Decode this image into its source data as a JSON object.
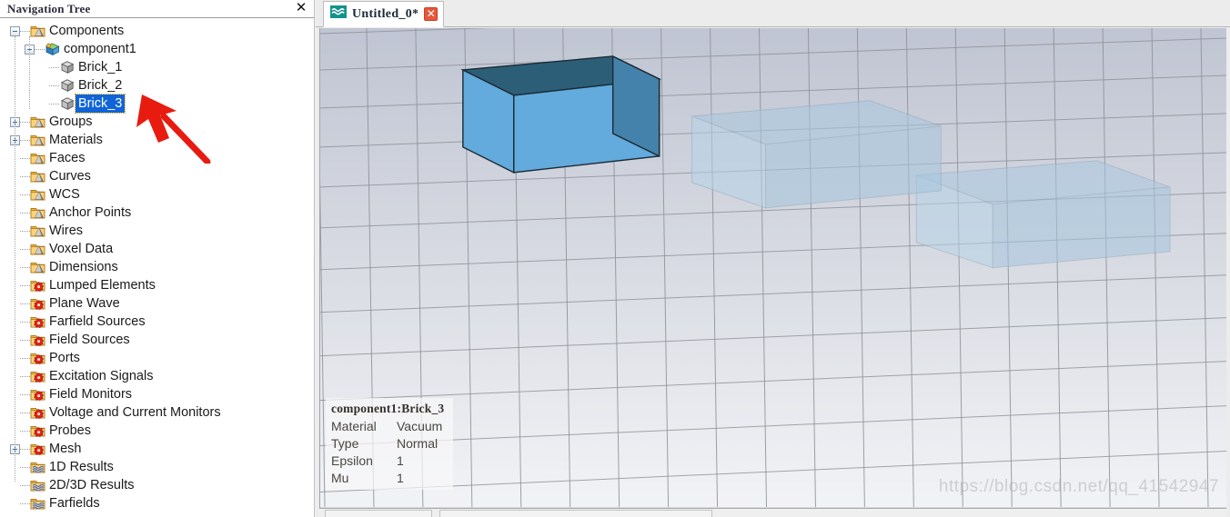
{
  "panel": {
    "title": "Navigation Tree",
    "close_icon": "close-icon",
    "close_label": "✕"
  },
  "tree": {
    "items": [
      {
        "label": "Components",
        "depth": 0,
        "expander": "minus",
        "icon": "folder-cone-icon",
        "selected": false
      },
      {
        "label": "component1",
        "depth": 1,
        "expander": "minus",
        "icon": "component-cube-icon",
        "selected": false
      },
      {
        "label": "Brick_1",
        "depth": 2,
        "expander": "none",
        "icon": "brick-icon",
        "selected": false
      },
      {
        "label": "Brick_2",
        "depth": 2,
        "expander": "none",
        "icon": "brick-icon",
        "selected": false
      },
      {
        "label": "Brick_3",
        "depth": 2,
        "expander": "none",
        "icon": "brick-icon",
        "selected": true
      },
      {
        "label": "Groups",
        "depth": 0,
        "expander": "plus",
        "icon": "folder-cone-icon",
        "selected": false
      },
      {
        "label": "Materials",
        "depth": 0,
        "expander": "plus",
        "icon": "folder-cone-icon",
        "selected": false
      },
      {
        "label": "Faces",
        "depth": 0,
        "expander": "none",
        "icon": "folder-cone-icon",
        "selected": false
      },
      {
        "label": "Curves",
        "depth": 0,
        "expander": "none",
        "icon": "folder-cone-icon",
        "selected": false
      },
      {
        "label": "WCS",
        "depth": 0,
        "expander": "none",
        "icon": "folder-cone-icon",
        "selected": false
      },
      {
        "label": "Anchor Points",
        "depth": 0,
        "expander": "none",
        "icon": "folder-cone-icon",
        "selected": false
      },
      {
        "label": "Wires",
        "depth": 0,
        "expander": "none",
        "icon": "folder-cone-icon",
        "selected": false
      },
      {
        "label": "Voxel Data",
        "depth": 0,
        "expander": "none",
        "icon": "folder-cone-icon",
        "selected": false
      },
      {
        "label": "Dimensions",
        "depth": 0,
        "expander": "none",
        "icon": "folder-cone-icon",
        "selected": false
      },
      {
        "label": "Lumped Elements",
        "depth": 0,
        "expander": "none",
        "icon": "folder-gear-icon",
        "selected": false
      },
      {
        "label": "Plane Wave",
        "depth": 0,
        "expander": "none",
        "icon": "folder-gear-icon",
        "selected": false
      },
      {
        "label": "Farfield Sources",
        "depth": 0,
        "expander": "none",
        "icon": "folder-gear-icon",
        "selected": false
      },
      {
        "label": "Field Sources",
        "depth": 0,
        "expander": "none",
        "icon": "folder-gear-icon",
        "selected": false
      },
      {
        "label": "Ports",
        "depth": 0,
        "expander": "none",
        "icon": "folder-gear-icon",
        "selected": false
      },
      {
        "label": "Excitation Signals",
        "depth": 0,
        "expander": "none",
        "icon": "folder-gear-icon",
        "selected": false
      },
      {
        "label": "Field Monitors",
        "depth": 0,
        "expander": "none",
        "icon": "folder-gear-icon",
        "selected": false
      },
      {
        "label": "Voltage and Current Monitors",
        "depth": 0,
        "expander": "none",
        "icon": "folder-gear-icon",
        "selected": false
      },
      {
        "label": "Probes",
        "depth": 0,
        "expander": "none",
        "icon": "folder-gear-icon",
        "selected": false
      },
      {
        "label": "Mesh",
        "depth": 0,
        "expander": "plus",
        "icon": "folder-gear-icon",
        "selected": false
      },
      {
        "label": "1D Results",
        "depth": 0,
        "expander": "none",
        "icon": "folder-wave-icon",
        "selected": false
      },
      {
        "label": "2D/3D Results",
        "depth": 0,
        "expander": "none",
        "icon": "folder-wave-icon",
        "selected": false
      },
      {
        "label": "Farfields",
        "depth": 0,
        "expander": "none",
        "icon": "folder-wave-icon",
        "selected": false
      }
    ]
  },
  "tab": {
    "label": "Untitled_0*",
    "icon": "wave-document-icon",
    "close_label": "✕"
  },
  "info": {
    "title": "component1:Brick_3",
    "rows": [
      {
        "key": "Material",
        "value": "Vacuum"
      },
      {
        "key": "Type",
        "value": "Normal"
      },
      {
        "key": "Epsilon",
        "value": "1"
      },
      {
        "key": "Mu",
        "value": "1"
      }
    ]
  },
  "watermark": {
    "text": "https://blog.csdn.net/qq_41542947"
  },
  "annotation": {
    "arrow": "red-arrow-pointer"
  },
  "colors": {
    "selection_blue": "#1064d8",
    "focus_gold": "#d9a400",
    "brick_solid_front": "#5ba7db",
    "brick_solid_top": "#2e5f77",
    "brick_solid_side": "#4483ab",
    "brick_ghost": "#9dc3e0",
    "tab_close_red": "#e8563c",
    "tab_icon_teal": "#15928c",
    "arrow_red": "#e81b10",
    "bg_top": "#c2c7d4",
    "bg_bottom": "#eceef2"
  },
  "scene": {
    "objects": [
      {
        "name": "brick-solid-selected",
        "style": "opaque"
      },
      {
        "name": "brick-ghost-middle",
        "style": "transparent"
      },
      {
        "name": "brick-ghost-right",
        "style": "transparent"
      }
    ]
  }
}
